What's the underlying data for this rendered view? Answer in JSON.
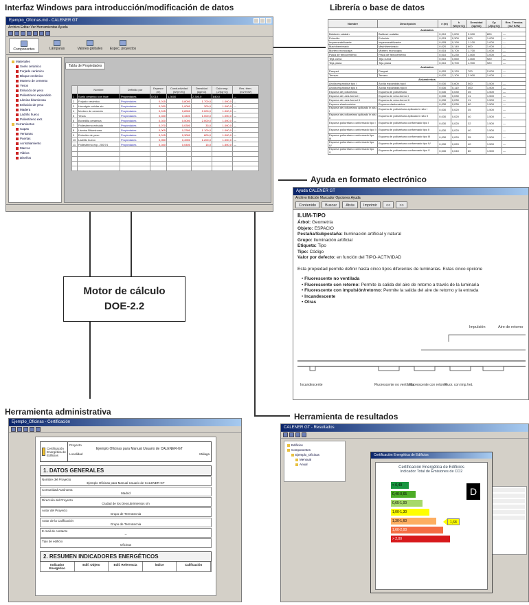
{
  "captions": {
    "interfaz": "Interfaz Windows para introducción/modificación de datos",
    "libreria": "Librería o base de datos",
    "ayuda": "Ayuda en formato electrónico",
    "administrativa": "Herramienta administrativa",
    "resultados": "Herramienta de resultados",
    "motor_line1": "Motor de cálculo",
    "motor_line2": "DOE-2.2"
  },
  "interfaz_window": {
    "title": "Ejemplo_Oficinas.md - CALENER GT",
    "menu": "Archivo  Editar  Ver  Herramientas  Ayuda",
    "tabs": [
      "Componentes",
      "Lámparas",
      "Valores globales",
      "Espec. proyectos"
    ],
    "sheet_tab": "Tabla de Propiedades",
    "tree_items": [
      "Materiales",
      "Suelo cerámico",
      "Forjado cerámico",
      "Bloque cerámico",
      "Mortero de cemento",
      "Yesos",
      "Enlucido de yeso",
      "Poliestireno expandido",
      "Lámina bituminosa",
      "Enlucido de yeso",
      "Madera",
      "Ladrillo hueco",
      "Poliestireno extr.",
      "Cerramientos",
      "Capas",
      "Ventanas",
      "Puertas",
      "Acristalamiento",
      "Marcos",
      "Vidrios",
      "Diseños"
    ],
    "columns": [
      "",
      "Nombre",
      "Definido por",
      "Espesor (m)",
      "Conductividad (W/(m·K))",
      "Densidad (kg/m3)",
      "Calor esp. (J/(kg·K))",
      "Res. térm. (m2·K/W)"
    ],
    "rows": [
      [
        "1",
        "Suelo cerámico con fase",
        "Propiedades",
        "0,010",
        "1,3000",
        "2.300,0",
        "840,0",
        "—"
      ],
      [
        "2",
        "Forjado cerámico",
        "Propiedades",
        "0,015",
        "0,8000",
        "1.700,0",
        "1.000,0",
        "—"
      ],
      [
        "3",
        "Hormigón celular sin",
        "Propiedades",
        "0,030",
        "1,0000",
        "300,0",
        "1.000,0",
        "—"
      ],
      [
        "4",
        "Mortero de cemento",
        "Propiedades",
        "0,015",
        "0,8900",
        "2.000,0",
        "1.000,0",
        "—"
      ],
      [
        "5",
        "Yesos",
        "Propiedades",
        "0,040",
        "0,4400",
        "1.000,0",
        "1.000,0",
        "—"
      ],
      [
        "6",
        "Bovedilla cerámica",
        "Propiedades",
        "0,020",
        "0,5000",
        "2.000,0",
        "1.000,0",
        "—"
      ],
      [
        "7",
        "Poliestireno extruido",
        "Propiedades",
        "0,070",
        "0,0300",
        "33,0",
        "1.000,0",
        "—"
      ],
      [
        "8",
        "Lámina Bituminosa",
        "Propiedades",
        "0,005",
        "0,2300",
        "1.100,0",
        "1.000,0",
        "—"
      ],
      [
        "9",
        "Enlucido de yeso",
        "Propiedades",
        "0,015",
        "0,3000",
        "800,0",
        "1.000,0",
        "—"
      ],
      [
        "10",
        "Ladrillo hueco",
        "Propiedades",
        "0,050",
        "0,4900",
        "1.200,0",
        "1.000,0",
        "—"
      ],
      [
        "11",
        "Poliestireno exp. 200/74",
        "Propiedades",
        "0,040",
        "0,0400",
        "15,0",
        "1.500,0",
        "—"
      ]
    ]
  },
  "libreria": {
    "columns": [
      "Nombre",
      "Descripción",
      "e (m)",
      "k (W/(m·K))",
      "Densidad (kg/m3)",
      "Cp (J/(kg·K))",
      "Res. Térmica (m2·K/W)"
    ],
    "sections": [
      {
        "title": "Acabados",
        "rows": [
          [
            "Baldosín catalán",
            "Baldosín catalán",
            "0,010",
            "1,000",
            "2.000",
            "800",
            "—"
          ],
          [
            "Enlucido",
            "Enlucido",
            "0,015",
            "0,300",
            "800",
            "1.000",
            "—"
          ],
          [
            "Impermeabilizante",
            "Impermeabilizante",
            "0,005",
            "0,190",
            "1.100",
            "1.000",
            "—"
          ],
          [
            "Machihembrado",
            "Machihembrado",
            "0,020",
            "0,140",
            "600",
            "1.000",
            "—"
          ],
          [
            "Mortero monocapa",
            "Mortero monocapa",
            "0,015",
            "0,700",
            "1.700",
            "1.000",
            "—"
          ],
          [
            "Placa de fibrocemento",
            "Placa de fibrocemento",
            "0,010",
            "0,230",
            "1.800",
            "1.000",
            "—"
          ],
          [
            "Teja curva",
            "Teja curva",
            "0,010",
            "0,550",
            "1.800",
            "920",
            "—"
          ],
          [
            "Teja plana",
            "Teja plana",
            "0,010",
            "0,700",
            "1.900",
            "920",
            "—"
          ]
        ]
      },
      {
        "title": "Acabados",
        "rows": [
          [
            "Parquet",
            "Parquet",
            "0,020",
            "0,120",
            "700",
            "2.000",
            "—"
          ],
          [
            "Terrazo",
            "Terrazo",
            "0,020",
            "1,100",
            "2.000",
            "1.000",
            "—"
          ]
        ]
      },
      {
        "title": "Aislamientos",
        "rows": [
          [
            "Arcilla expandida tipo I",
            "Arcilla expandida tipo I",
            "0,030",
            "0,600",
            "500",
            "1.500",
            "—"
          ],
          [
            "Arcilla expandida tipo II",
            "Arcilla expandida tipo II",
            "0,030",
            "0,110",
            "400",
            "1.500",
            "—"
          ],
          [
            "Espuma de poliuretano",
            "Espuma de poliuretano",
            "0,030",
            "0,030",
            "35",
            "1.500",
            "—"
          ],
          [
            "Espuma de urea-formol I",
            "Espuma de urea-formol I",
            "0,030",
            "0,030",
            "11",
            "1.500",
            "—"
          ],
          [
            "Espuma de urea-formol II",
            "Espuma de urea-formol II",
            "0,030",
            "0,030",
            "11",
            "1.500",
            "—"
          ],
          [
            "Espuma elastomérica",
            "Espuma elastomérica",
            "0,030",
            "0,030",
            "60",
            "1.500",
            "—"
          ],
          [
            "Espuma de poliuretano aplicado in situ I",
            "Espuma de poliuretano aplicado in situ I",
            "0,030",
            "0,020",
            "35",
            "1.500",
            "—"
          ],
          [
            "Espuma de poliuretano aplicado in situ II",
            "Espuma de poliuretano aplicado in situ II",
            "0,030",
            "0,020",
            "40",
            "1.500",
            "—"
          ],
          [
            "Espuma poliuretano conformado tipo I",
            "Espuma de poliuretano conformado tipo I",
            "0,030",
            "0,020",
            "32",
            "1.500",
            "—"
          ],
          [
            "Espuma poliuretano conformado tipo II",
            "Espuma de poliuretano conformado tipo II",
            "0,030",
            "0,020",
            "40",
            "1.500",
            "—"
          ],
          [
            "Espuma poliuretano conformado tipo III",
            "Espuma de poliuretano conformado tipo III",
            "0,030",
            "0,020",
            "35",
            "1.500",
            "—"
          ],
          [
            "Espuma poliuretano conformado tipo IV",
            "Espuma de poliuretano conformado tipo IV",
            "0,030",
            "0,020",
            "40",
            "1.500",
            "—"
          ],
          [
            "Espuma poliuretano conformado tipo V",
            "Espuma de poliuretano conformado tipo V",
            "0,030",
            "0,040",
            "80",
            "1.500",
            "—"
          ]
        ]
      }
    ]
  },
  "ayuda_window": {
    "title": "Ayuda CALENER GT",
    "menu": "Archivo  Edición  Marcador  Opciones  Ayuda",
    "buttons": [
      "Contenido",
      "Buscar",
      "Atrás",
      "Imprimir",
      "<<",
      ">>"
    ],
    "heading": "ILUM-TIPO",
    "fields": [
      {
        "label": "Árbol:",
        "value": "Geometría"
      },
      {
        "label": "Objeto:",
        "value": "ESPACIO"
      },
      {
        "label": "Pestaña/Subpestaña:",
        "value": "Iluminación artificial y natural"
      },
      {
        "label": "Grupo:",
        "value": "Iluminación artificial"
      },
      {
        "label": "Etiqueta:",
        "value": "Tipo"
      },
      {
        "label": "Tipo:",
        "value": "Código"
      },
      {
        "label": "Valor por defecto:",
        "value": "en función del TIPO-ACTIVIDAD"
      }
    ],
    "paragraph": "Esta propiedad permite definir hasta cinco tipos diferentes de luminarias. Estas cinco opcione",
    "bullets": [
      {
        "bold": "Fluorescente no ventilada",
        "rest": ""
      },
      {
        "bold": "Fluorescente con retorno:",
        "rest": " Permite la salida del aire de retorno a través de la luminaria"
      },
      {
        "bold": "Fluorescente con impulsión/retorno:",
        "rest": " Permite la salida del aire de retorno y la entrada"
      },
      {
        "bold": "Incandescente",
        "rest": ""
      },
      {
        "bold": "Otras",
        "rest": ""
      }
    ],
    "diagram_labels": [
      "Incandescente",
      "Fluorescente no ventilada",
      "Fluorescente con retorno",
      "Fluor. con imp./ret."
    ],
    "diagram_top_labels": [
      "Impulsión",
      "Aire de retorno"
    ]
  },
  "admin_window": {
    "title": "Ejemplo_Oficinas - Certificación",
    "header_left": "Certificación Energética de Edificios",
    "project_label": "Proyecto",
    "project_value": "Ejemplo Oficinas para Manual Usuario de CALENER-GT",
    "location_label": "Localidad",
    "location_value": "Málaga",
    "section1": "1. DATOS GENERALES",
    "fields": [
      {
        "label": "Nombre del Proyecto",
        "value": "Ejemplo Oficinas para Manual Usuario de CALENER-GT"
      },
      {
        "label": "Comunidad Autónoma",
        "value": "Madrid"
      },
      {
        "label": "Dirección del Proyecto",
        "value": "Ciudad de los Descubrimientos s/n"
      },
      {
        "label": "Autor del Proyecto",
        "value": "Grupo de Termotecnia"
      },
      {
        "label": "Autor de la Calificación",
        "value": "Grupo de Termotecnia"
      },
      {
        "label": "E-mail de contacto",
        "value": "--"
      },
      {
        "label": "Tipo de edificio",
        "value": "Oficinas"
      }
    ],
    "section2": "2. RESUMEN INDICADORES ENERGÉTICOS",
    "table_headers": [
      "Indicador Energético",
      "Edif. Objeto",
      "Edif. Referencia",
      "Índice",
      "Calificación"
    ]
  },
  "resultados_window": {
    "title": "CALENER GT - Resultados",
    "dialog_title": "Certificación Energética de Edificios",
    "dialog_subtitle": "Indicador Total de Emisiones de CO2",
    "grade": "D",
    "arrow_value": "1,68",
    "tree_items": [
      "Edificios",
      "Componentes",
      "Ejemplo_Oficinas",
      "Mensual",
      "Anual"
    ],
    "bars": [
      {
        "label": "< 0,40",
        "color": "#1a9641"
      },
      {
        "label": "0,40-0,65",
        "color": "#4dac26"
      },
      {
        "label": "0,65-1,00",
        "color": "#a6d96a"
      },
      {
        "label": "1,00-1,30",
        "color": "#ffff00"
      },
      {
        "label": "1,30-1,60",
        "color": "#fdae61"
      },
      {
        "label": "1,60-2,00",
        "color": "#f46d43"
      },
      {
        "label": "> 2,00",
        "color": "#d7191c"
      }
    ]
  }
}
